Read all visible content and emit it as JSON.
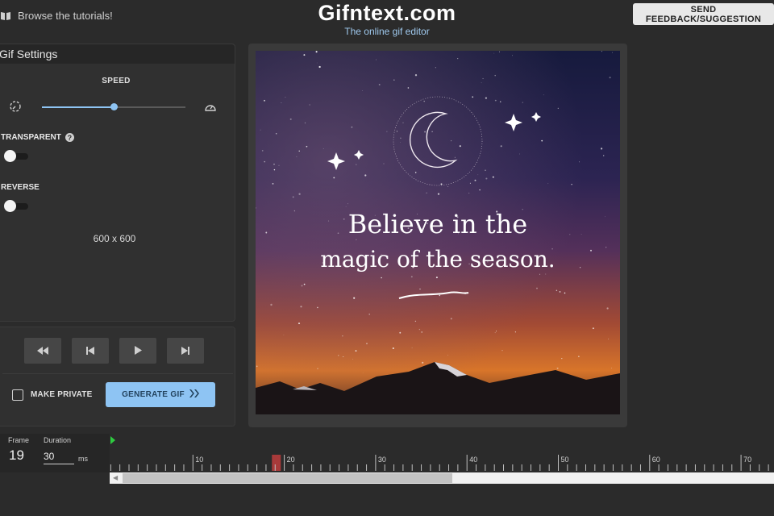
{
  "header": {
    "tutorials_label": "Browse the tutorials!",
    "brand_title": "Gifntext.com",
    "brand_subtitle": "The online gif editor",
    "feedback_label": "SEND FEEDBACK/SUGGESTION"
  },
  "settings": {
    "title": "Gif Settings",
    "speed_label": "SPEED",
    "speed_fraction": 0.5,
    "transparent_label": "TRANSPARENT",
    "transparent_on": false,
    "help_glyph": "?",
    "reverse_label": "REVERSE",
    "reverse_on": false,
    "dimensions": "600 x 600"
  },
  "controls": {
    "buttons": [
      "rewind-icon",
      "step-back-icon",
      "play-icon",
      "step-forward-icon"
    ],
    "private_label": "MAKE PRIVATE",
    "private_checked": false,
    "generate_label": "GENERATE GIF"
  },
  "canvas": {
    "line1": "Believe in the",
    "line2": "magic of the season."
  },
  "timeline": {
    "frame_label": "Frame",
    "frame_value": "19",
    "duration_label": "Duration",
    "duration_value": "30",
    "duration_unit": "ms",
    "ruler_labels": [
      "10",
      "20",
      "30",
      "40",
      "50",
      "60",
      "70"
    ],
    "current_frame": 19,
    "visible_fraction": 0.5
  },
  "colors": {
    "accent": "#8ec4f3",
    "playhead": "#a83a3a",
    "start_marker": "#2ecc40"
  }
}
